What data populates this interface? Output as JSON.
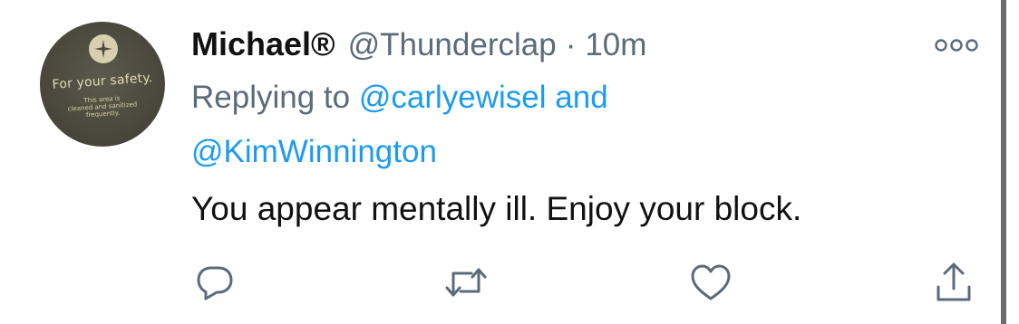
{
  "author": {
    "name": "Michael®",
    "handle": "@Thunderclap",
    "separator": "·",
    "time": "10m",
    "avatar": {
      "headline": "For your safety.",
      "fine_print": [
        "This area is",
        "cleaned and sanitized",
        "frequently."
      ]
    }
  },
  "replying": {
    "prefix": "Replying to",
    "mention_1": "@carlyewisel",
    "conjunction": "and",
    "mention_2": "@KimWinnington"
  },
  "tweet": {
    "text": "You appear mentally ill. Enjoy your block."
  },
  "actions": {
    "reply_icon": "reply-icon",
    "retweet_icon": "retweet-icon",
    "like_icon": "heart-icon",
    "share_icon": "share-icon",
    "more_icon": "more-options-icon"
  },
  "colors": {
    "text": "#111111",
    "secondary": "#5b6b79",
    "link": "#1d9bf0",
    "icon": "#5b6b79"
  }
}
